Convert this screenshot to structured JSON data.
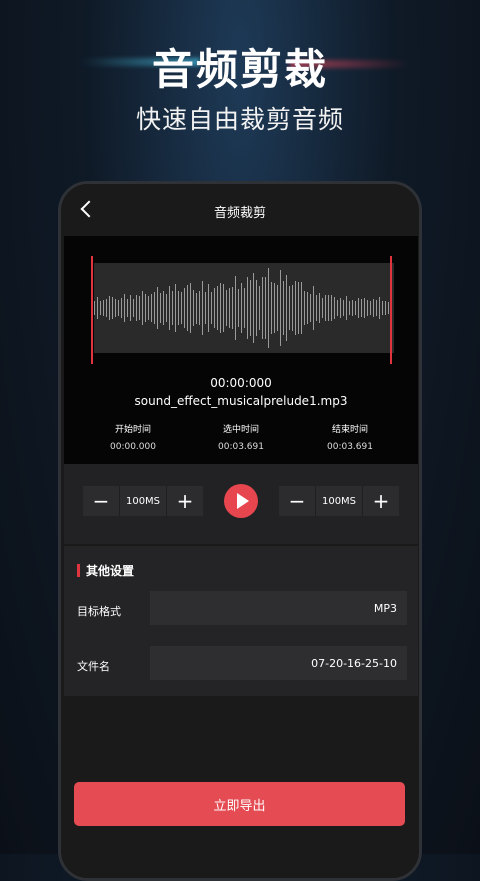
{
  "promo": {
    "title": "音频剪裁",
    "subtitle": "快速自由裁剪音频"
  },
  "screen": {
    "title": "音频裁剪",
    "back_icon": "chevron-left-icon"
  },
  "player": {
    "current_time": "00:00:000",
    "filename": "sound_effect_musicalprelude1.mp3",
    "start_label": "开始时间",
    "start_value": "00:00.000",
    "selected_label": "选中时间",
    "selected_value": "00:03.691",
    "end_label": "结束时间",
    "end_value": "00:03.691",
    "marker_color": "#e0353f"
  },
  "controls": {
    "left_step": "100MS",
    "right_step": "100MS",
    "minus_symbol": "−",
    "plus_symbol": "+",
    "play_icon": "play-icon",
    "accent": "#e8464f"
  },
  "settings": {
    "section_title": "其他设置",
    "format_label": "目标格式",
    "format_value": "MP3",
    "filename_label": "文件名",
    "filename_value": "07-20-16-25-10"
  },
  "export": {
    "label": "立即导出",
    "color": "#e54b52"
  }
}
